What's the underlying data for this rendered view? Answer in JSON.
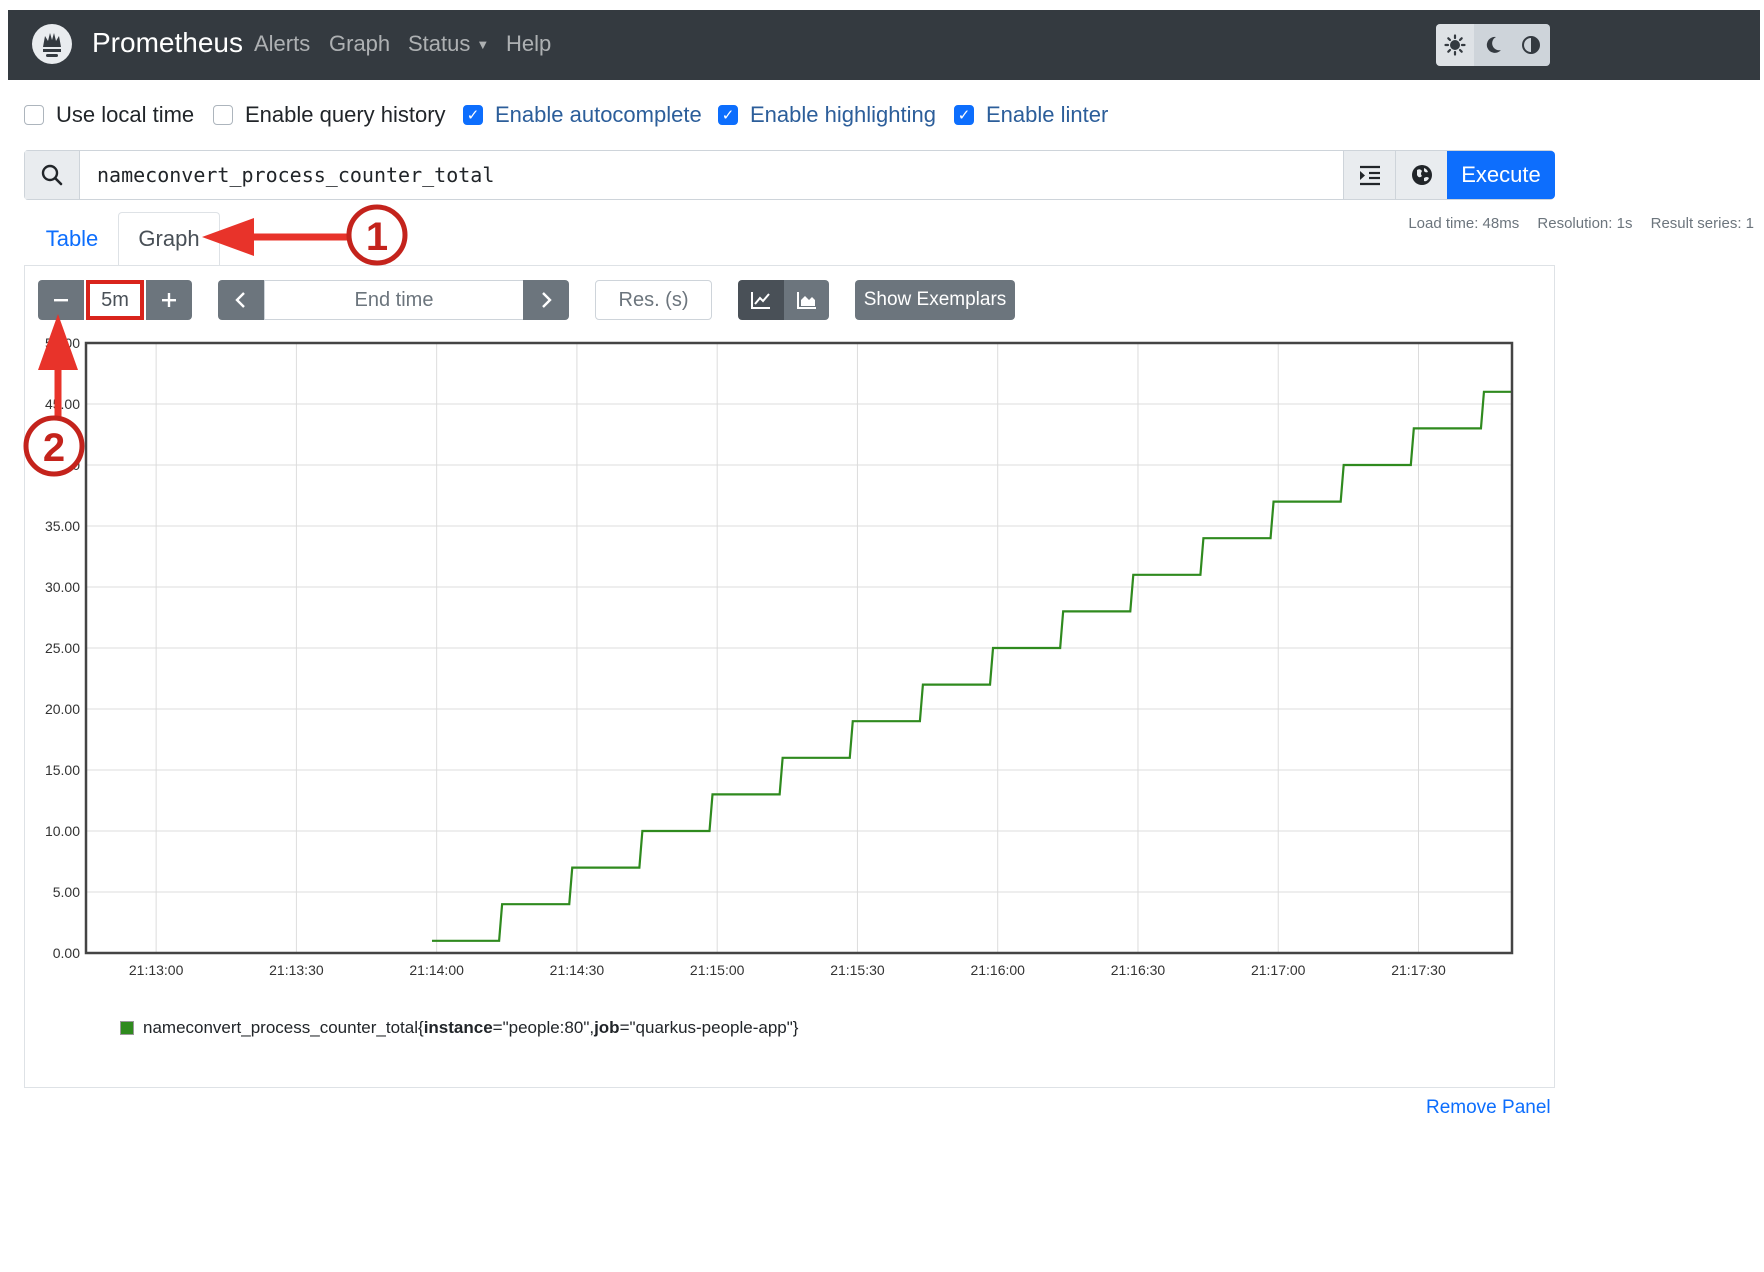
{
  "navbar": {
    "brand": "Prometheus",
    "links": [
      "Alerts",
      "Graph",
      "Status",
      "Help"
    ]
  },
  "options": [
    {
      "label": "Use local time",
      "checked": false
    },
    {
      "label": "Enable query history",
      "checked": false
    },
    {
      "label": "Enable autocomplete",
      "checked": true
    },
    {
      "label": "Enable highlighting",
      "checked": true
    },
    {
      "label": "Enable linter",
      "checked": true
    }
  ],
  "expression": {
    "value": "nameconvert_process_counter_total",
    "execute_label": "Execute"
  },
  "tabs": {
    "table": "Table",
    "graph": "Graph"
  },
  "stats": {
    "load_time": "Load time: 48ms",
    "resolution": "Resolution: 1s",
    "result_series": "Result series: 1"
  },
  "controls": {
    "range": "5m",
    "end_time_placeholder": "End time",
    "res_placeholder": "Res. (s)",
    "show_exemplars": "Show Exemplars"
  },
  "annotations": {
    "step1": "1",
    "step2": "2",
    "color": "#e8332a"
  },
  "legend": {
    "metric": "nameconvert_process_counter_total",
    "open_brace": "{",
    "k1": "instance",
    "v1": "=\"people:80\", ",
    "k2": "job",
    "v2": "=\"quarkus-people-app\"}"
  },
  "remove_panel": "Remove Panel",
  "colors": {
    "series": "#2f8a1e",
    "primary": "#0d6efd",
    "navbar": "#343a40"
  },
  "chart_data": {
    "type": "line",
    "step": true,
    "series": [
      {
        "name": "nameconvert_process_counter_total{instance=\"people:80\", job=\"quarkus-people-app\"}",
        "points": [
          [
            "21:13:59",
            1
          ],
          [
            "21:14:14",
            4
          ],
          [
            "21:14:29",
            7
          ],
          [
            "21:14:44",
            10
          ],
          [
            "21:14:59",
            13
          ],
          [
            "21:15:14",
            16
          ],
          [
            "21:15:29",
            19
          ],
          [
            "21:15:44",
            22
          ],
          [
            "21:15:59",
            25
          ],
          [
            "21:16:14",
            28
          ],
          [
            "21:16:29",
            31
          ],
          [
            "21:16:44",
            34
          ],
          [
            "21:16:59",
            37
          ],
          [
            "21:17:14",
            40
          ],
          [
            "21:17:29",
            43
          ],
          [
            "21:17:44",
            46
          ]
        ]
      }
    ],
    "x_ticks": [
      "21:13:00",
      "21:13:30",
      "21:14:00",
      "21:14:30",
      "21:15:00",
      "21:15:30",
      "21:16:00",
      "21:16:30",
      "21:17:00",
      "21:17:30"
    ],
    "y_ticks": [
      "0.00",
      "5.00",
      "10.00",
      "15.00",
      "20.00",
      "25.00",
      "30.00",
      "35.00",
      "40.00",
      "45.00",
      "50.00"
    ],
    "xlim": [
      "21:12:45",
      "21:17:50"
    ],
    "ylim": [
      0,
      50
    ],
    "grid": true
  }
}
